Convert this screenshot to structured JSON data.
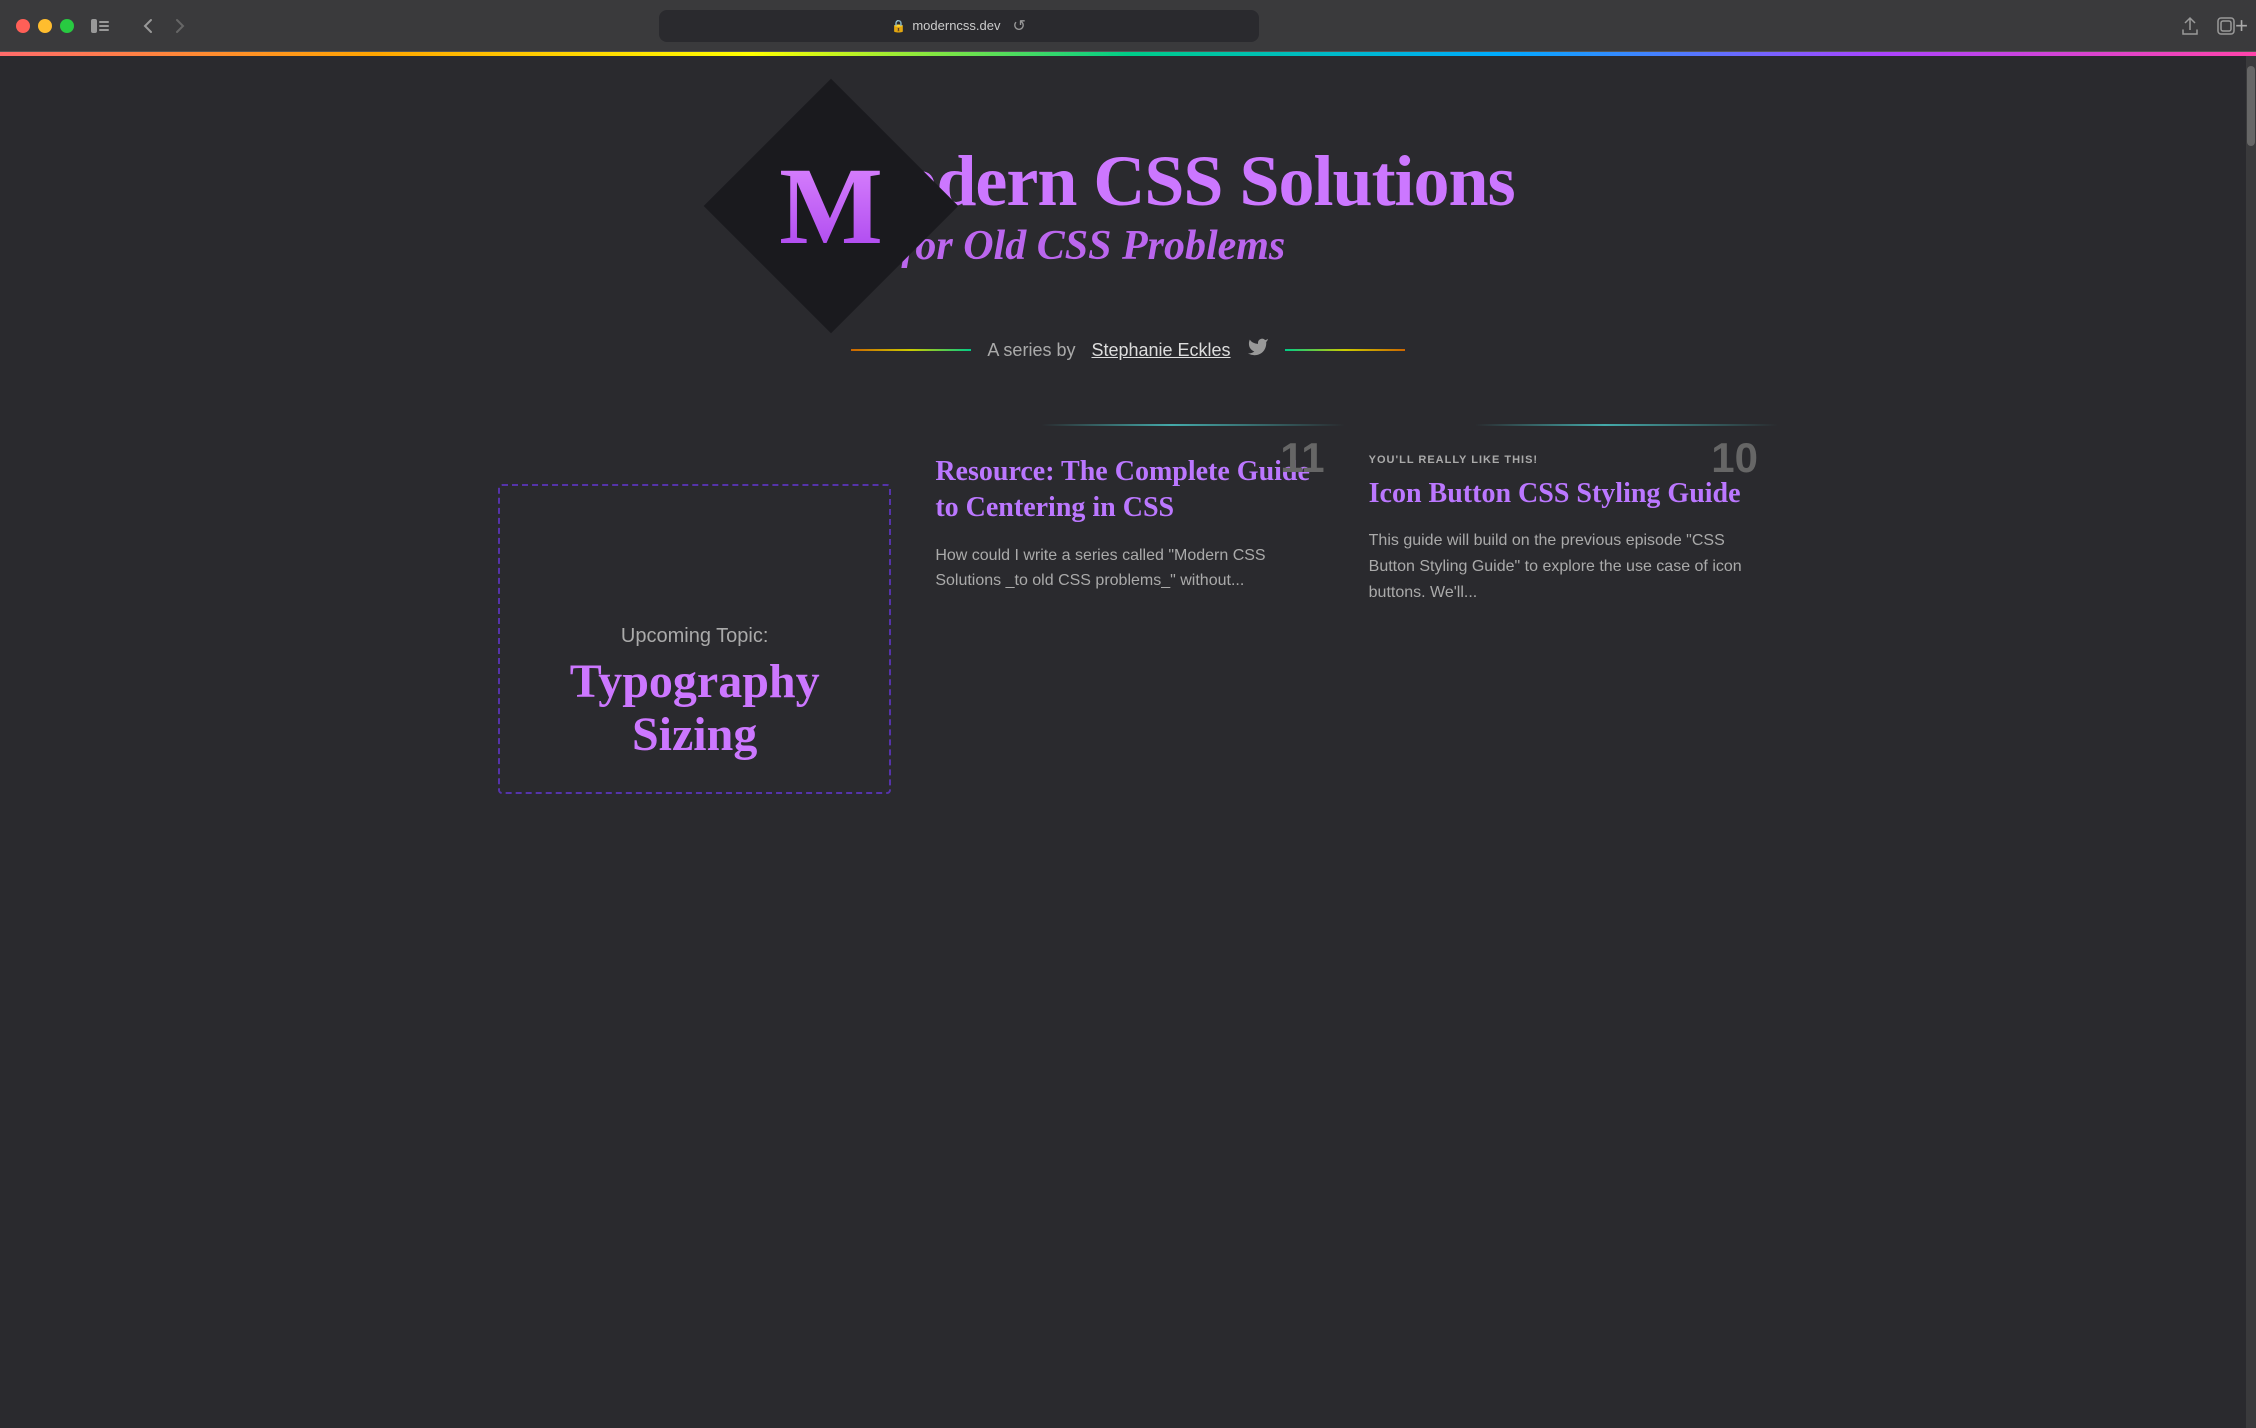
{
  "browser": {
    "url": "moderncss.dev",
    "back_btn": "‹",
    "forward_btn": "›",
    "reload_btn": "↺",
    "share_btn": "⬆",
    "tab_btn": "⧉",
    "add_tab": "+",
    "sidebar_icon": "⊡"
  },
  "page": {
    "logo_letter": "M",
    "title_main": "odern CSS Solutions",
    "title_sub": "for Old CSS Problems",
    "author_prefix": "A series by",
    "author_name": "Stephanie Eckles"
  },
  "cards": [
    {
      "type": "upcoming",
      "label": "Upcoming Topic:",
      "title": "Typography\nSizing"
    },
    {
      "type": "resource",
      "number": "11",
      "tag": null,
      "title": "Resource: The Complete Guide to Centering in CSS",
      "excerpt": "How could I write a series called \"Modern CSS Solutions _to old CSS problems_\" without..."
    },
    {
      "type": "featured",
      "number": "10",
      "tag": "YOU'LL REALLY LIKE THIS!",
      "title": "Icon Button CSS Styling Guide",
      "excerpt": "This guide will build on the previous episode \"CSS Button Styling Guide\" to explore the use case of icon buttons. We'll..."
    }
  ]
}
